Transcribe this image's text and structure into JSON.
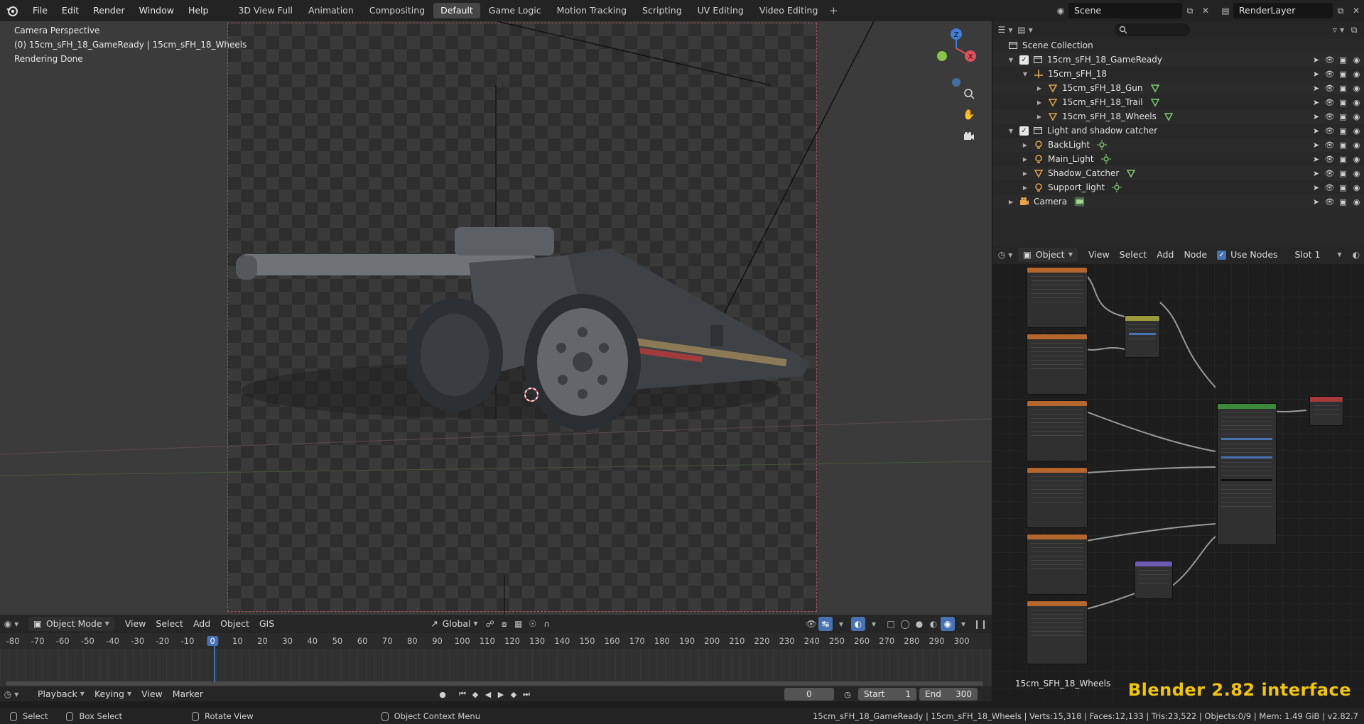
{
  "topbar": {
    "menus": [
      "File",
      "Edit",
      "Render",
      "Window",
      "Help"
    ],
    "workspaces": [
      "3D View Full",
      "Animation",
      "Compositing",
      "Default",
      "Game Logic",
      "Motion Tracking",
      "Scripting",
      "UV Editing",
      "Video Editing"
    ],
    "active_workspace": "Default",
    "scene_name": "Scene",
    "view_layer_name": "RenderLayer"
  },
  "viewport": {
    "overlay_lines": [
      "Camera Perspective",
      "(0) 15cm_sFH_18_GameReady | 15cm_sFH_18_Wheels",
      "Rendering Done"
    ],
    "gizmo_axes": [
      "Z",
      "X"
    ],
    "axis_colors": {
      "x": "#e0505a",
      "y": "#8bc34a",
      "z": "#3f7fd8"
    }
  },
  "viewport_header": {
    "mode": "Object Mode",
    "menus": [
      "View",
      "Select",
      "Add",
      "Object",
      "GIS"
    ],
    "transform_orientation": "Global"
  },
  "timeline": {
    "ticks": [
      "-80",
      "-70",
      "-60",
      "-50",
      "-40",
      "-30",
      "-20",
      "-10",
      "0",
      "10",
      "20",
      "30",
      "40",
      "50",
      "60",
      "70",
      "80",
      "90",
      "100",
      "110",
      "120",
      "130",
      "140",
      "150",
      "160",
      "170",
      "180",
      "190",
      "200",
      "210",
      "220",
      "230",
      "240",
      "250",
      "260",
      "270",
      "280",
      "290",
      "300"
    ],
    "current_frame": "0",
    "menus": [
      "Playback",
      "Keying",
      "View",
      "Marker"
    ],
    "frame_field": "0",
    "start_label": "Start",
    "start_value": "1",
    "end_label": "End",
    "end_value": "300"
  },
  "outliner": {
    "search_placeholder": "",
    "root": "Scene Collection",
    "rows": [
      {
        "label": "15cm_sFH_18_GameReady",
        "type": "collection"
      },
      {
        "label": "15cm_sFH_18",
        "type": "empty"
      },
      {
        "label": "15cm_sFH_18_Gun",
        "type": "mesh"
      },
      {
        "label": "15cm_sFH_18_Trail",
        "type": "mesh"
      },
      {
        "label": "15cm_sFH_18_Wheels",
        "type": "mesh"
      },
      {
        "label": "Light and shadow catcher",
        "type": "collection"
      },
      {
        "label": "BackLight",
        "type": "light"
      },
      {
        "label": "Main_Light",
        "type": "light"
      },
      {
        "label": "Shadow_Catcher",
        "type": "mesh"
      },
      {
        "label": "Support_light",
        "type": "light"
      },
      {
        "label": "Camera",
        "type": "camera"
      }
    ]
  },
  "node_editor": {
    "object_dropdown": "Object",
    "menus": [
      "View",
      "Select",
      "Add",
      "Node"
    ],
    "use_nodes_label": "Use Nodes",
    "slot": "Slot 1",
    "material_name": "15cm_SFH_18_Wheels",
    "node_colors": {
      "image_texture": "#b5662d",
      "mix": "#9a9a3a",
      "principled": "#3a8a3a",
      "output": "#a63a3a",
      "normal_map": "#6a5ab0"
    }
  },
  "watermark": "Blender 2.82 interface",
  "statusbar": {
    "left": [
      {
        "label": "Select"
      },
      {
        "label": "Box Select"
      },
      {
        "label": "Rotate View"
      },
      {
        "label": "Object Context Menu"
      }
    ],
    "right": "15cm_sFH_18_GameReady | 15cm_sFH_18_Wheels | Verts:15,318 | Faces:12,133 | Tris:23,522 | Objects:0/9 | Mem: 1.49 GiB | v2.82.7"
  }
}
